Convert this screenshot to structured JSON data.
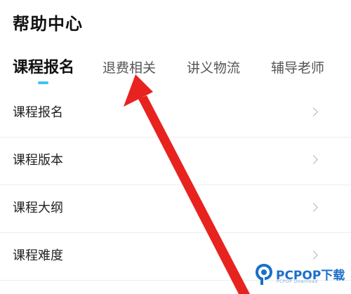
{
  "header": {
    "title": "帮助中心"
  },
  "tabs": [
    {
      "label": "课程报名",
      "active": true
    },
    {
      "label": "退费相关",
      "active": false
    },
    {
      "label": "讲义物流",
      "active": false
    },
    {
      "label": "辅导老师",
      "active": false
    }
  ],
  "list": [
    {
      "label": "课程报名"
    },
    {
      "label": "课程版本"
    },
    {
      "label": "课程大纲"
    },
    {
      "label": "课程难度"
    }
  ],
  "colors": {
    "accent": "#3ec4f0",
    "annotation": "#e8231f",
    "watermark": "#1a6fc9"
  },
  "icons": {
    "row_chevron": "chevron-right-icon",
    "watermark_logo": "pcpop-logo-icon"
  },
  "watermark": {
    "brand": "PCPOP下载",
    "sub": "PCPOP Download"
  }
}
